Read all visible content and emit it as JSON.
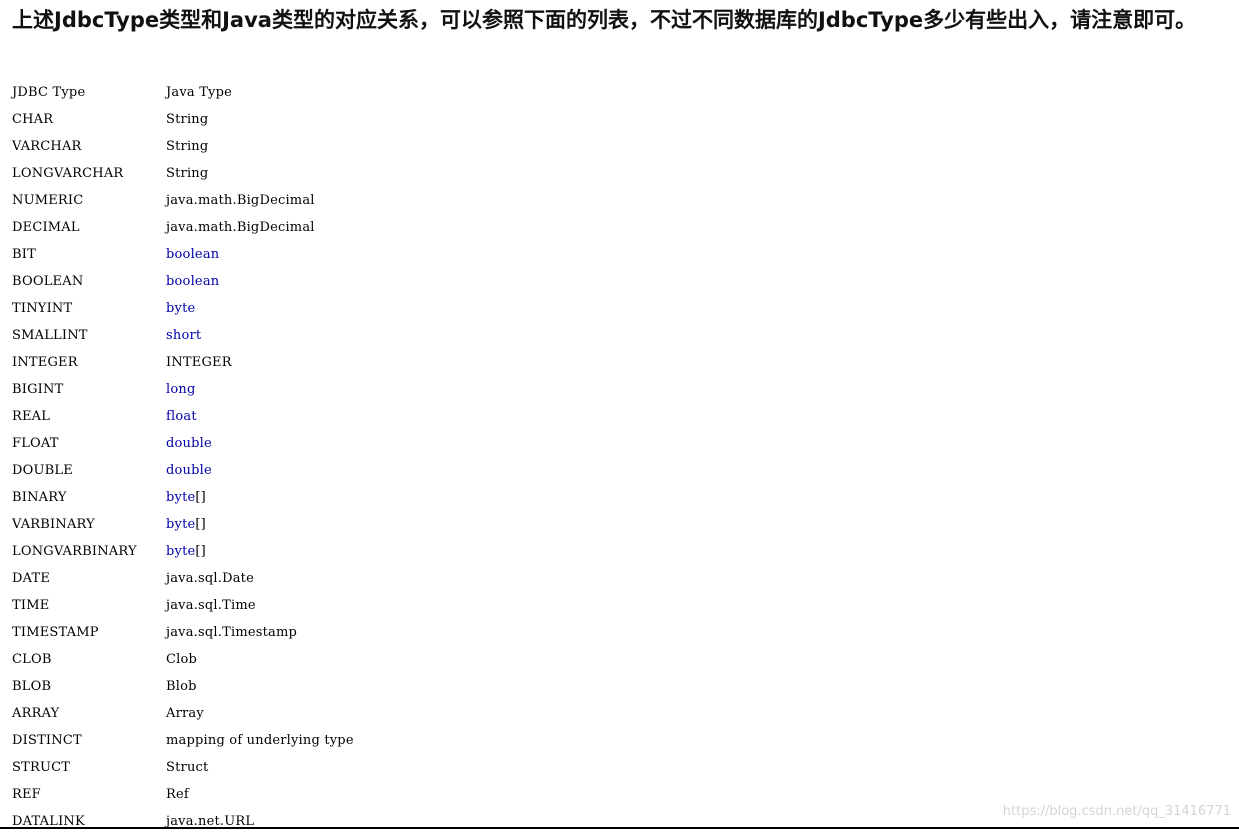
{
  "heading": "上述JdbcType类型和Java类型的对应关系，可以参照下面的列表，不过不同数据库的JdbcType多少有些出入，请注意即可。",
  "table": {
    "header": {
      "jdbc": "JDBC Type",
      "java": "Java Type"
    },
    "rows": [
      {
        "jdbc": "CHAR",
        "java": "String",
        "java_suffix": "",
        "keyword": false
      },
      {
        "jdbc": "VARCHAR",
        "java": "String",
        "java_suffix": "",
        "keyword": false
      },
      {
        "jdbc": "LONGVARCHAR",
        "java": "String",
        "java_suffix": "",
        "keyword": false
      },
      {
        "jdbc": "NUMERIC",
        "java": "java.math.BigDecimal",
        "java_suffix": "",
        "keyword": false
      },
      {
        "jdbc": "DECIMAL",
        "java": "java.math.BigDecimal",
        "java_suffix": "",
        "keyword": false
      },
      {
        "jdbc": "BIT",
        "java": "boolean",
        "java_suffix": "",
        "keyword": true
      },
      {
        "jdbc": "BOOLEAN",
        "java": "boolean",
        "java_suffix": "",
        "keyword": true
      },
      {
        "jdbc": "TINYINT",
        "java": "byte",
        "java_suffix": "",
        "keyword": true
      },
      {
        "jdbc": "SMALLINT",
        "java": "short",
        "java_suffix": "",
        "keyword": true
      },
      {
        "jdbc": "INTEGER",
        "java": "INTEGER",
        "java_suffix": "",
        "keyword": false
      },
      {
        "jdbc": "BIGINT",
        "java": "long",
        "java_suffix": "",
        "keyword": true
      },
      {
        "jdbc": "REAL",
        "java": "float",
        "java_suffix": "",
        "keyword": true
      },
      {
        "jdbc": "FLOAT",
        "java": "double",
        "java_suffix": "",
        "keyword": true
      },
      {
        "jdbc": "DOUBLE",
        "java": "double",
        "java_suffix": "",
        "keyword": true
      },
      {
        "jdbc": "BINARY",
        "java": "byte",
        "java_suffix": "[]",
        "keyword": true
      },
      {
        "jdbc": "VARBINARY",
        "java": "byte",
        "java_suffix": "[]",
        "keyword": true
      },
      {
        "jdbc": "LONGVARBINARY",
        "java": "byte",
        "java_suffix": "[]",
        "keyword": true
      },
      {
        "jdbc": "DATE",
        "java": "java.sql.Date",
        "java_suffix": "",
        "keyword": false
      },
      {
        "jdbc": "TIME",
        "java": "java.sql.Time",
        "java_suffix": "",
        "keyword": false
      },
      {
        "jdbc": "TIMESTAMP",
        "java": "java.sql.Timestamp",
        "java_suffix": "",
        "keyword": false
      },
      {
        "jdbc": "CLOB",
        "java": "Clob",
        "java_suffix": "",
        "keyword": false
      },
      {
        "jdbc": "BLOB",
        "java": "Blob",
        "java_suffix": "",
        "keyword": false
      },
      {
        "jdbc": "ARRAY",
        "java": "Array",
        "java_suffix": "",
        "keyword": false
      },
      {
        "jdbc": "DISTINCT",
        "java": "mapping of underlying type",
        "java_suffix": "",
        "keyword": false
      },
      {
        "jdbc": "STRUCT",
        "java": "Struct",
        "java_suffix": "",
        "keyword": false
      },
      {
        "jdbc": "REF",
        "java": "Ref",
        "java_suffix": "",
        "keyword": false
      },
      {
        "jdbc": "DATALINK",
        "java": "java.net.URL",
        "java_suffix": "",
        "keyword": false
      }
    ]
  },
  "watermark": "https://blog.csdn.net/qq_31416771",
  "colors": {
    "keyword": "#0000aa",
    "text": "#000000",
    "watermark": "#d4d4d4"
  }
}
